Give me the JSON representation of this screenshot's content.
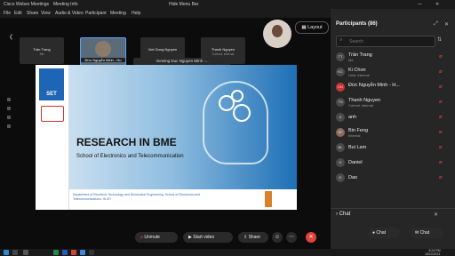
{
  "window": {
    "title": "Cisco Webex Meetings",
    "meeting_info": "Meeting Info",
    "hide_menu_bar": "Hide Menu Bar"
  },
  "menu": [
    "File",
    "Edit",
    "Share",
    "View",
    "Audio & Video",
    "Participant",
    "Meeting",
    "Help"
  ],
  "layout_button": "Layout",
  "thumbnails": [
    {
      "name": "Trần Trang",
      "role": "Me"
    },
    {
      "name": "Đức Nguyễn Minh - Hu",
      "role": "",
      "active": true
    },
    {
      "name": "Viet Dung Nguyen",
      "role": ""
    },
    {
      "name": "Thanh Nguyen",
      "role": "Cohost, internal"
    }
  ],
  "viewing_label": "Viewing Duc Nguyen Minh -...",
  "slide": {
    "logo_text": "SET",
    "title": "RESEARCH IN BME",
    "subtitle": "School of Electronics and Telecommunication",
    "footer": "Department of Electronic Technology and Biomedical Engineering, School of Electronics and Telecommunications, HUST"
  },
  "participants": {
    "header": "Participants (86)",
    "search_placeholder": "Search",
    "items": [
      {
        "initials": "TT",
        "name": "Trần Trang",
        "role": "Me"
      },
      {
        "initials": "KC",
        "name": "Ki Chon",
        "role": "Host, internal"
      },
      {
        "initials": "DN",
        "name": "Đức Nguyễn Minh - H...",
        "role": ""
      },
      {
        "initials": "TN",
        "name": "Thanh Nguyen",
        "role": "Cohost, internal"
      },
      {
        "initials": "A",
        "name": "anh",
        "role": ""
      },
      {
        "initials": "BF",
        "name": "Bin Feng",
        "role": "Internal"
      },
      {
        "initials": "BL",
        "name": "Bui Lam",
        "role": ""
      },
      {
        "initials": "D",
        "name": "Daniel",
        "role": ""
      },
      {
        "initials": "D",
        "name": "Dao",
        "role": ""
      }
    ]
  },
  "chat": {
    "label": "Chat",
    "button": "Chat"
  },
  "controls": {
    "unmute": "Unmute",
    "start_video": "Start video",
    "share": "Share"
  },
  "clock": {
    "time": "8:24 PM",
    "date": "18/10/2021"
  }
}
